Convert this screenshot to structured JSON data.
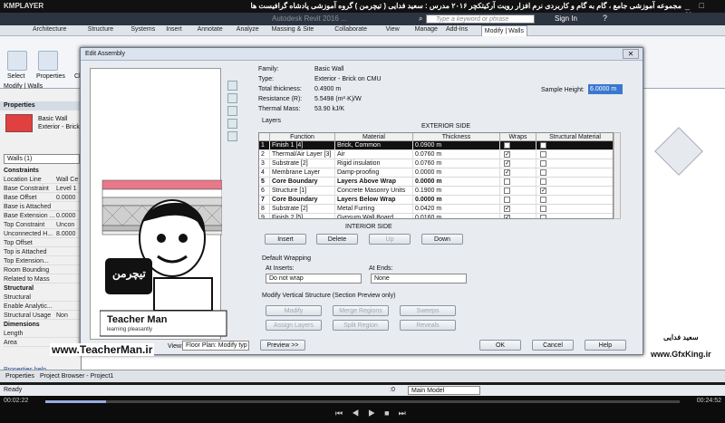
{
  "player": {
    "logo": "KMPLAYER",
    "title": "مجموعه آموزشی جامع ، گام به گام و کاربردی نرم افزار رویت آرکیتکچر ۲۰۱۶   مدرس : سعید فدایی ( تیچرمن ) گروه آموزشی پادشاه گرافیست ها",
    "time_elapsed": "00:02:22",
    "time_total": "00:24:52"
  },
  "revit": {
    "title_center": "Autodesk Revit 2016 ...",
    "search_placeholder": "Type a keyword or phrase",
    "signin": "Sign In",
    "tabs": [
      "Architecture",
      "Structure",
      "Systems",
      "Insert",
      "Annotate",
      "Analyze",
      "Massing & Site",
      "Collaborate",
      "View",
      "Manage",
      "Add-Ins",
      "Modify | Walls"
    ],
    "ribbon_labels": [
      "Modify",
      "Select",
      "Properties",
      "Cl"
    ],
    "context_label": "Modify | Walls",
    "status": "Ready",
    "status_zero": ":0",
    "main_model": "Main Model"
  },
  "properties": {
    "header": "Properties",
    "type_name": "Basic Wall",
    "type_sub": "Exterior - Brick",
    "selector": "Walls (1)",
    "section_constraints": "Constraints",
    "rows": [
      {
        "k": "Location Line",
        "v": "Wall Ce"
      },
      {
        "k": "Base Constraint",
        "v": "Level 1"
      },
      {
        "k": "Base Offset",
        "v": "0.0000"
      },
      {
        "k": "Base is Attached",
        "v": ""
      },
      {
        "k": "Base Extension ...",
        "v": "0.0000"
      },
      {
        "k": "Top Constraint",
        "v": "Uncon"
      },
      {
        "k": "Unconnected H...",
        "v": "8.0000"
      },
      {
        "k": "Top Offset",
        "v": ""
      },
      {
        "k": "Top is Attached",
        "v": ""
      },
      {
        "k": "Top Extension...",
        "v": ""
      },
      {
        "k": "Room Bounding",
        "v": ""
      },
      {
        "k": "Related to Mass",
        "v": ""
      }
    ],
    "section_structural": "Structural",
    "rows2": [
      {
        "k": "Structural",
        "v": ""
      },
      {
        "k": "Enable Analytic...",
        "v": ""
      },
      {
        "k": "Structural Usage",
        "v": "Non"
      }
    ],
    "section_dimensions": "Dimensions",
    "rows3": [
      {
        "k": "Length",
        "v": ""
      },
      {
        "k": "Area",
        "v": ""
      }
    ],
    "help": "Properties help",
    "apply": "Apply",
    "tab_properties": "Properties",
    "tab_browser": "Project Browser - Project1"
  },
  "dialog": {
    "title": "Edit Assembly",
    "close": "✕",
    "family_k": "Family:",
    "family_v": "Basic Wall",
    "type_k": "Type:",
    "type_v": "Exterior - Brick on CMU",
    "thick_k": "Total thickness:",
    "thick_v": "0.4900 m",
    "res_k": "Resistance (R):",
    "res_v": "5.5498 (m²·K)/W",
    "mass_k": "Thermal Mass:",
    "mass_v": "53.90 kJ/K",
    "sample_k": "Sample Height:",
    "sample_v": "6.0000 m",
    "layers_label": "Layers",
    "exterior_side": "EXTERIOR SIDE",
    "interior_side": "INTERIOR SIDE",
    "columns": [
      "",
      "Function",
      "Material",
      "Thickness",
      "Wraps",
      "Structural Material"
    ],
    "rows": [
      {
        "n": "1",
        "f": "Finish 1 [4]",
        "m": "Brick, Common",
        "t": "0.0900 m",
        "w": true,
        "s": false,
        "sel": true,
        "bold": false
      },
      {
        "n": "2",
        "f": "Thermal/Air Layer [3]",
        "m": "Air",
        "t": "0.0760 m",
        "w": true,
        "s": false,
        "sel": false,
        "bold": false
      },
      {
        "n": "3",
        "f": "Substrate [2]",
        "m": "Rigid insulation",
        "t": "0.0760 m",
        "w": true,
        "s": false,
        "sel": false,
        "bold": false
      },
      {
        "n": "4",
        "f": "Membrane Layer",
        "m": "Damp-proofing",
        "t": "0.0000 m",
        "w": true,
        "s": false,
        "sel": false,
        "bold": false
      },
      {
        "n": "5",
        "f": "Core Boundary",
        "m": "Layers Above Wrap",
        "t": "0.0000 m",
        "w": false,
        "s": false,
        "sel": false,
        "bold": true
      },
      {
        "n": "6",
        "f": "Structure [1]",
        "m": "Concrete Masonry Units",
        "t": "0.1900 m",
        "w": false,
        "s": true,
        "sel": false,
        "bold": false
      },
      {
        "n": "7",
        "f": "Core Boundary",
        "m": "Layers Below Wrap",
        "t": "0.0000 m",
        "w": false,
        "s": false,
        "sel": false,
        "bold": true
      },
      {
        "n": "8",
        "f": "Substrate [2]",
        "m": "Metal Furring",
        "t": "0.0420 m",
        "w": true,
        "s": false,
        "sel": false,
        "bold": false
      },
      {
        "n": "9",
        "f": "Finish 2 [5]",
        "m": "Gypsum Wall Board",
        "t": "0.0160 m",
        "w": true,
        "s": false,
        "sel": false,
        "bold": false
      }
    ],
    "btn_insert": "Insert",
    "btn_delete": "Delete",
    "btn_up": "Up",
    "btn_down": "Down",
    "default_wrapping": "Default Wrapping",
    "at_inserts": "At Inserts:",
    "at_inserts_v": "Do not wrap",
    "at_ends": "At Ends:",
    "at_ends_v": "None",
    "modify_vertical": "Modify Vertical Structure (Section Preview only)",
    "btn_modify": "Modify",
    "btn_merge": "Merge Regions",
    "btn_sweeps": "Sweeps",
    "btn_assign": "Assign Layers",
    "btn_split": "Split Region",
    "btn_reveals": "Reveals",
    "view_k": "View:",
    "view_v": "Floor Plan: Modify typ",
    "btn_preview": "Preview >>",
    "btn_ok": "OK",
    "btn_cancel": "Cancel",
    "btn_help": "Help"
  },
  "overlay": {
    "teacher_fa": "تیچرمن",
    "teacher_en": "Teacher Man",
    "teacher_sub": "learning pleasantly",
    "site_left": "www.TeacherMan.ir",
    "site_right": "www.GfxKing.ir",
    "author_fa": "سعید فدایی"
  }
}
